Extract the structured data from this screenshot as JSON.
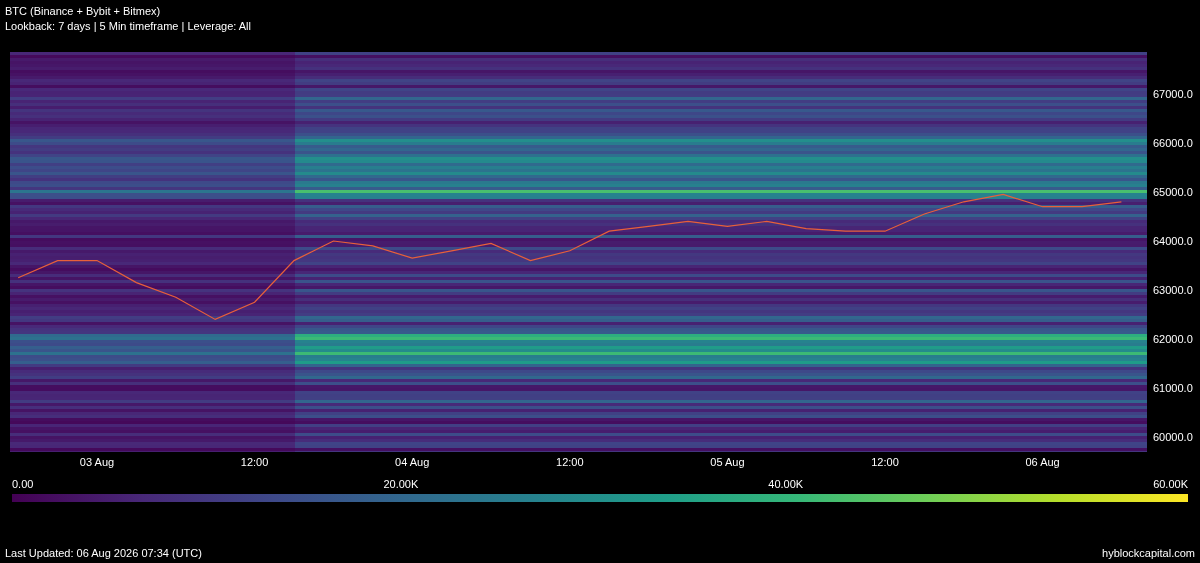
{
  "title": "BTC (Binance + Bybit + Bitmex)",
  "subtitle": "Lookback: 7 days | 5 Min timeframe | Leverage: All",
  "chart_data": {
    "type": "line",
    "categories": [
      null,
      null,
      "03 Aug",
      null,
      null,
      null,
      "12:00",
      null,
      null,
      null,
      "04 Aug",
      null,
      null,
      null,
      "12:00",
      null,
      null,
      null,
      "05 Aug",
      null,
      null,
      null,
      "12:00",
      null,
      null,
      null,
      "06 Aug",
      null,
      null,
      null
    ],
    "series": [
      {
        "color": "#e8603a",
        "values": [
          63250,
          63600,
          63600,
          63150,
          62850,
          62400,
          62750,
          63600,
          64000,
          63900,
          63650,
          63800,
          63950,
          63600,
          63800,
          64200,
          64300,
          64400,
          64300,
          64400,
          64250,
          64200,
          64200,
          64550,
          64800,
          64950,
          64700,
          64700,
          64800,
          null
        ]
      }
    ],
    "ylim": [
      59693,
      67857
    ],
    "yticks": [
      {
        "value": 67000,
        "label": "67000.0"
      },
      {
        "value": 66000,
        "label": "66000.0"
      },
      {
        "value": 65000,
        "label": "65000.0"
      },
      {
        "value": 64000,
        "label": "64000.0"
      },
      {
        "value": 63000,
        "label": "63000.0"
      },
      {
        "value": 62000,
        "label": "62000.0"
      },
      {
        "value": 61000,
        "label": "61000.0"
      },
      {
        "value": 60000,
        "label": "60000.0"
      }
    ]
  },
  "colorbar_labels": [
    "0.00",
    "20.00K",
    "40.00K",
    "60.00K"
  ],
  "footer": {
    "last_updated": "Last Updated: 06 Aug 2026 07:34 (UTC)",
    "site": "hyblockcapital.com"
  }
}
